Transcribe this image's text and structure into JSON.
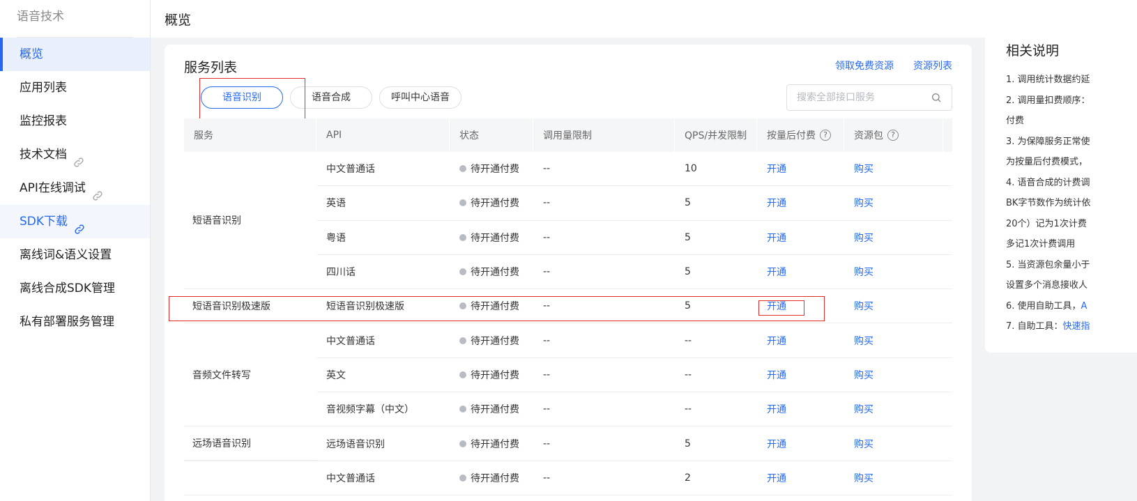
{
  "sidebar": {
    "title": "语音技术",
    "items": [
      {
        "label": "概览"
      },
      {
        "label": "应用列表"
      },
      {
        "label": "监控报表"
      },
      {
        "label": "技术文档"
      },
      {
        "label": "API在线调试"
      },
      {
        "label": "SDK下载"
      },
      {
        "label": "离线词&语义设置"
      },
      {
        "label": "离线合成SDK管理"
      },
      {
        "label": "私有部署服务管理"
      }
    ]
  },
  "header": {
    "title": "概览"
  },
  "card": {
    "title": "服务列表",
    "links": {
      "free": "领取免费资源",
      "resources": "资源列表"
    },
    "tabs": [
      "语音识别",
      "语音合成",
      "呼叫中心语音"
    ],
    "search": {
      "placeholder": "搜索全部接口服务"
    }
  },
  "table": {
    "headers": [
      "服务",
      "API",
      "状态",
      "调用量限制",
      "QPS/并发限制",
      "按量后付费",
      "资源包"
    ],
    "services": [
      "短语音识别",
      "短语音识别极速版",
      "音频文件转写",
      "远场语音识别"
    ],
    "rows": [
      {
        "api": "中文普通话",
        "status": "待开通付费",
        "limit": "--",
        "qps": "10",
        "open": "开通",
        "buy": "购买"
      },
      {
        "api": "英语",
        "status": "待开通付费",
        "limit": "--",
        "qps": "5",
        "open": "开通",
        "buy": "购买"
      },
      {
        "api": "粤语",
        "status": "待开通付费",
        "limit": "--",
        "qps": "5",
        "open": "开通",
        "buy": "购买"
      },
      {
        "api": "四川话",
        "status": "待开通付费",
        "limit": "--",
        "qps": "5",
        "open": "开通",
        "buy": "购买"
      },
      {
        "api": "短语音识别极速版",
        "status": "待开通付费",
        "limit": "--",
        "qps": "5",
        "open": "开通",
        "buy": "购买"
      },
      {
        "api": "中文普通话",
        "status": "待开通付费",
        "limit": "--",
        "qps": "--",
        "open": "开通",
        "buy": "购买"
      },
      {
        "api": "英文",
        "status": "待开通付费",
        "limit": "--",
        "qps": "--",
        "open": "开通",
        "buy": "购买"
      },
      {
        "api": "音视频字幕（中文）",
        "status": "待开通付费",
        "limit": "--",
        "qps": "--",
        "open": "开通",
        "buy": "购买"
      },
      {
        "api": "远场语音识别",
        "status": "待开通付费",
        "limit": "--",
        "qps": "5",
        "open": "开通",
        "buy": "购买"
      },
      {
        "api": "中文普通话",
        "status": "待开通付费",
        "limit": "--",
        "qps": "2",
        "open": "开通",
        "buy": "购买"
      }
    ]
  },
  "notes": {
    "title": "相关说明",
    "lines": [
      "1. 调用统计数据约延",
      "2. 调用量扣费顺序：",
      "付费",
      "3. 为保障服务正常使",
      "为按量后付费模式，",
      "4. 语音合成的计费调",
      "BK字节数作为统计依",
      "20个）记为1次计费",
      "多记1次计费调用",
      "5. 当资源包余量小于",
      "设置多个消息接收人",
      "6. 使用自助工具，",
      "7. 自助工具："
    ],
    "line6_link": "A",
    "line7_link": "快速指"
  },
  "colors": {
    "accent": "#2468f2",
    "highlight": "#e02b2b"
  }
}
